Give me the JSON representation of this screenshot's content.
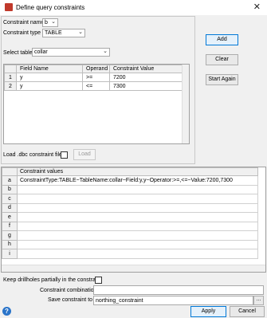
{
  "window": {
    "title": "Define query constraints",
    "close_glyph": "✕"
  },
  "form": {
    "constraint_name_label": "Constraint name",
    "constraint_name_value": "b",
    "constraint_type_label": "Constraint type",
    "constraint_type_value": "TABLE",
    "select_table_label": "Select table",
    "select_table_value": "collar"
  },
  "field_table": {
    "headers": [
      "",
      "Field Name",
      "Operand",
      "Constraint Value"
    ],
    "rows": [
      {
        "num": "1",
        "field": "y",
        "operand": ">=",
        "value": "7200"
      },
      {
        "num": "2",
        "field": "y",
        "operand": "<=",
        "value": "7300"
      }
    ]
  },
  "load": {
    "label": "Load .dbc constraint file",
    "button": "Load"
  },
  "side_buttons": {
    "add": "Add",
    "clear": "Clear",
    "start_again": "Start Again"
  },
  "values_table": {
    "header": "Constraint values",
    "rows": [
      {
        "label": "a",
        "value": "ConstraintType:TABLE~TableName:collar~Field:y,y~Operator:>=,<=~Value:7200,7300"
      },
      {
        "label": "b",
        "value": ""
      },
      {
        "label": "c",
        "value": ""
      },
      {
        "label": "d",
        "value": ""
      },
      {
        "label": "e",
        "value": ""
      },
      {
        "label": "f",
        "value": ""
      },
      {
        "label": "g",
        "value": ""
      },
      {
        "label": "h",
        "value": ""
      },
      {
        "label": "i",
        "value": ""
      }
    ]
  },
  "bottom": {
    "keep_label": "Keep drillholes partially in the constraint",
    "combination_label": "Constraint combination",
    "combination_value": "",
    "save_label": "Save constraint to",
    "save_value": "northing_constraint",
    "browse": "...",
    "apply": "Apply",
    "cancel": "Cancel",
    "help": "?"
  },
  "colors": {
    "accent": "#0078d7",
    "help": "#2a74c9",
    "app_icon": "#c0392b"
  }
}
